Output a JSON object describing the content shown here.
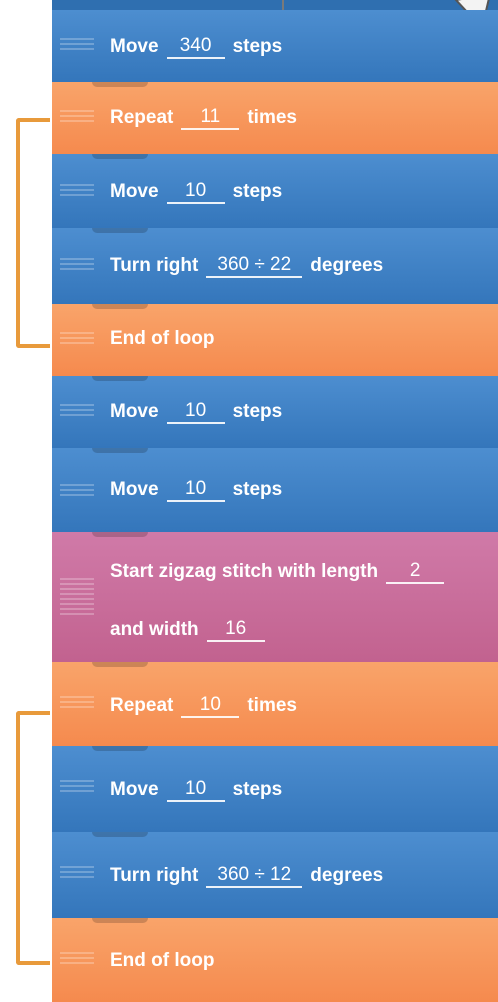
{
  "colors": {
    "move": "#3a7cc0",
    "loop": "#f7955a",
    "stitch": "#c96c9c",
    "bracket": "#e89a3b"
  },
  "blocks": [
    {
      "type": "move",
      "prefix": "Move",
      "value": "340",
      "suffix": "steps"
    },
    {
      "type": "loop",
      "prefix": "Repeat",
      "value": "11",
      "suffix": "times"
    },
    {
      "type": "move",
      "prefix": "Move",
      "value": "10",
      "suffix": "steps"
    },
    {
      "type": "turn",
      "prefix": "Turn right",
      "value": "360 ÷ 22",
      "suffix": "degrees"
    },
    {
      "type": "loop",
      "label": "End of loop"
    },
    {
      "type": "move",
      "prefix": "Move",
      "value": "10",
      "suffix": "steps"
    },
    {
      "type": "move",
      "prefix": "Move",
      "value": "10",
      "suffix": "steps"
    },
    {
      "type": "stitch",
      "line1_prefix": "Start zigzag stitch with length",
      "length": "2",
      "line2_prefix": "and width",
      "width": "16"
    },
    {
      "type": "loop",
      "prefix": "Repeat",
      "value": "10",
      "suffix": "times"
    },
    {
      "type": "move",
      "prefix": "Move",
      "value": "10",
      "suffix": "steps"
    },
    {
      "type": "turn",
      "prefix": "Turn right",
      "value": "360 ÷ 12",
      "suffix": "degrees"
    },
    {
      "type": "loop",
      "label": "End of loop"
    }
  ]
}
